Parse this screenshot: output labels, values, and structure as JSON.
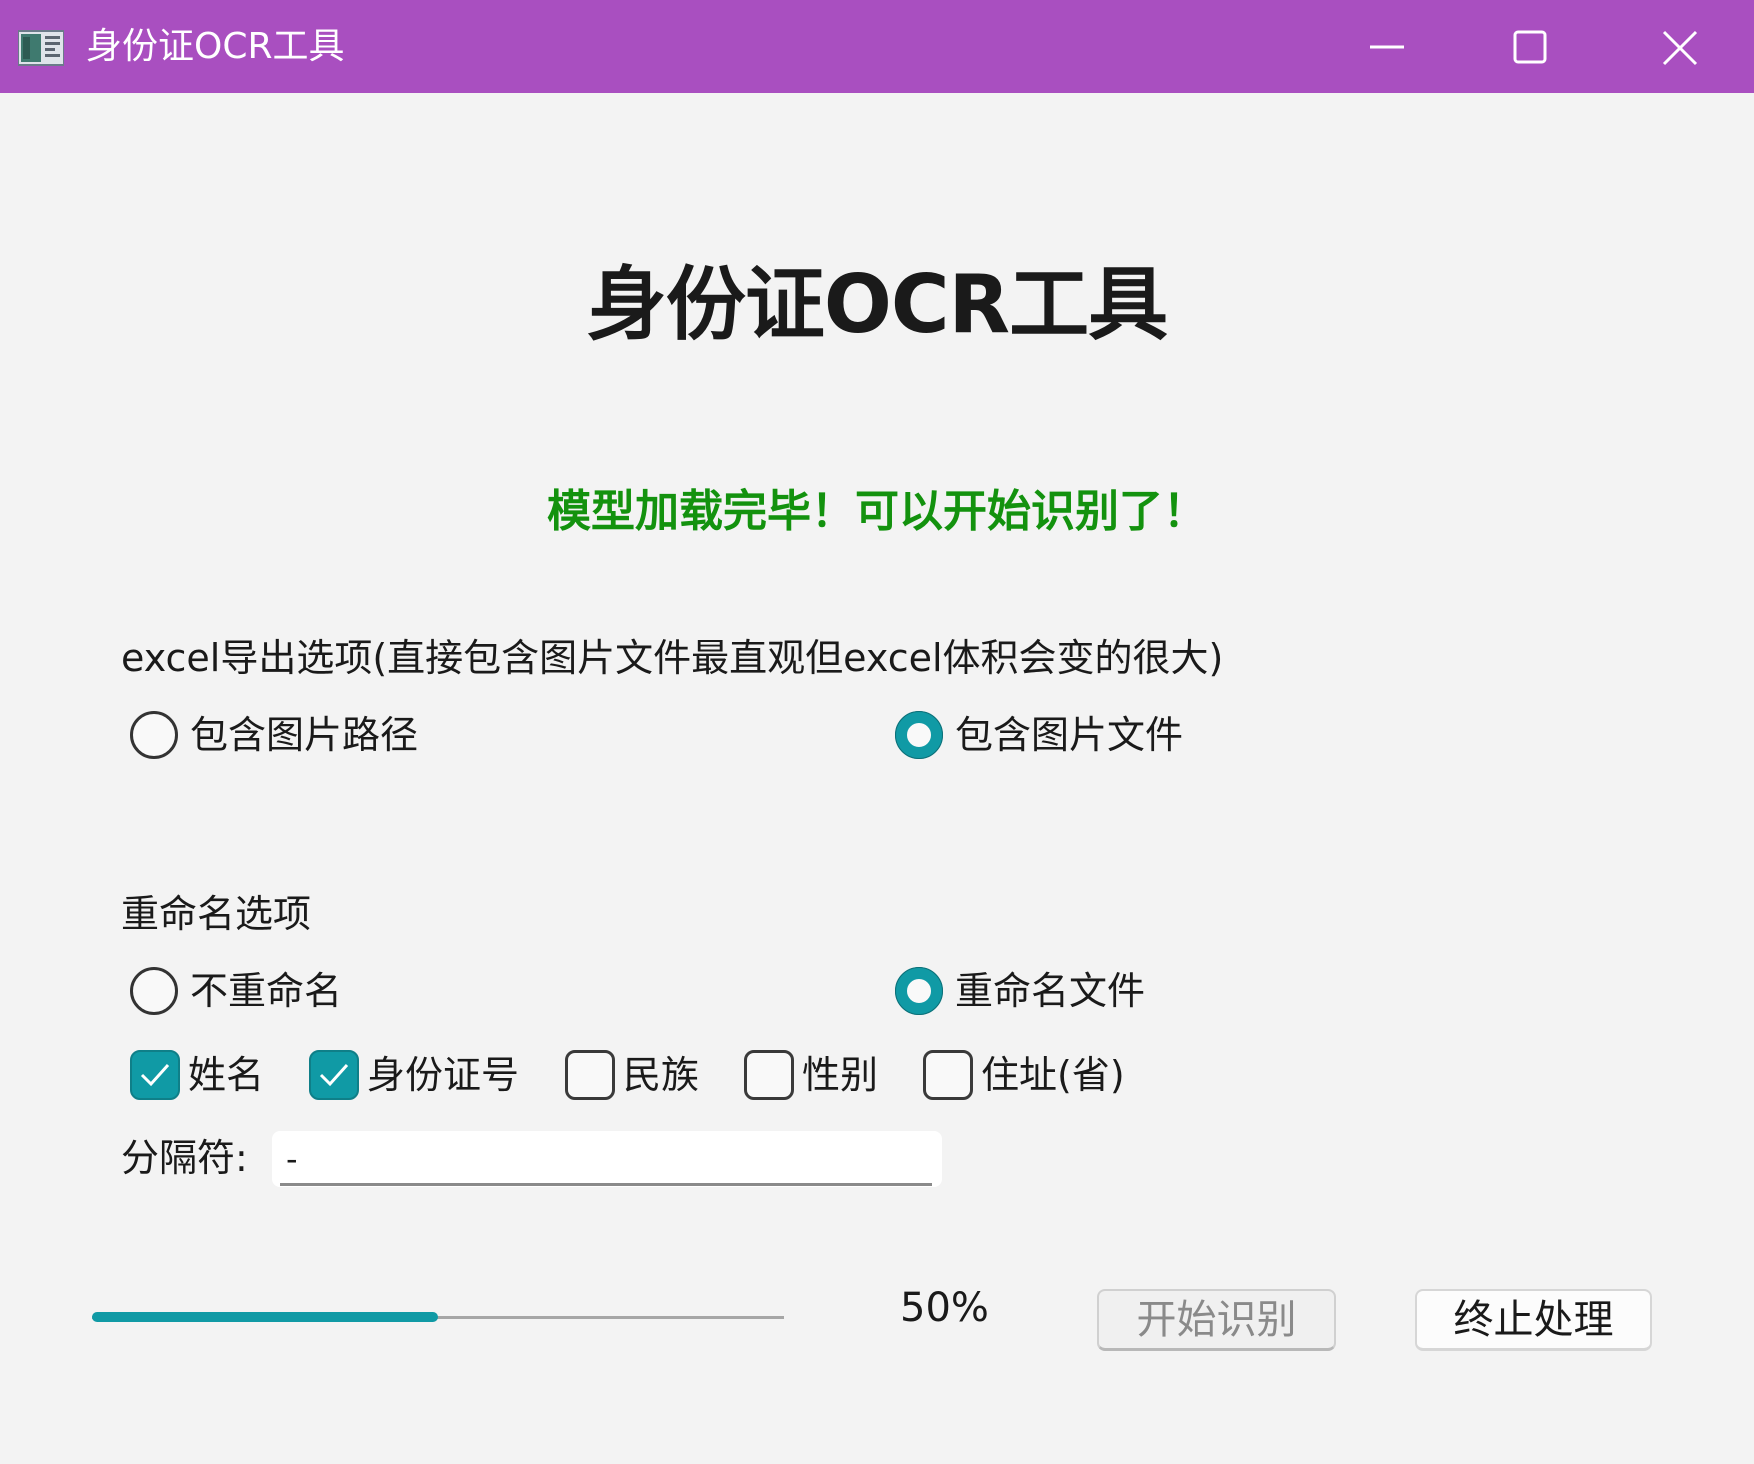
{
  "window": {
    "title": "身份证OCR工具",
    "title_bar_color": "#a94fc0",
    "icons": [
      "app-icon",
      "minimize-icon",
      "maximize-icon",
      "close-icon"
    ]
  },
  "header": {
    "title": "身份证OCR工具",
    "status": "模型加载完毕！可以开始识别了！",
    "status_color": "#13920e"
  },
  "excel_options": {
    "label": "excel导出选项(直接包含图片文件最直观但excel体积会变的很大)",
    "options": [
      {
        "label": "包含图片路径",
        "checked": false
      },
      {
        "label": "包含图片文件",
        "checked": true
      }
    ]
  },
  "rename_options": {
    "label": "重命名选项",
    "options": [
      {
        "label": "不重命名",
        "checked": false
      },
      {
        "label": "重命名文件",
        "checked": true
      }
    ],
    "fields": [
      {
        "label": "姓名",
        "checked": true
      },
      {
        "label": "身份证号",
        "checked": true
      },
      {
        "label": "民族",
        "checked": false
      },
      {
        "label": "性别",
        "checked": false
      },
      {
        "label": "住址(省)",
        "checked": false
      }
    ],
    "separator_label": "分隔符:",
    "separator_value": "-"
  },
  "progress": {
    "value": 0.5,
    "text": "50%",
    "accent_color": "#109aa5"
  },
  "buttons": {
    "start": "开始识别",
    "stop": "终止处理"
  }
}
